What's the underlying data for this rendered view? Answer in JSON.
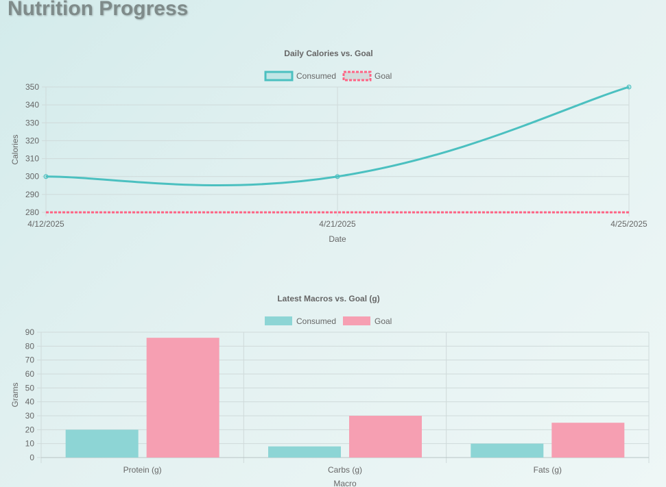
{
  "page": {
    "title": "Nutrition Progress"
  },
  "colors": {
    "consumed": "#4bc0c0",
    "goal": "#ff6384",
    "consumed_fill": "#8dd5d5",
    "goal_fill": "#f69fb2",
    "grid": "#cfdada",
    "text": "#666666"
  },
  "chart_data": [
    {
      "type": "line",
      "title": "Daily Calories vs. Goal",
      "xlabel": "Date",
      "ylabel": "Calories",
      "categories": [
        "4/12/2025",
        "4/21/2025",
        "4/25/2025"
      ],
      "series": [
        {
          "name": "Consumed",
          "values": [
            300,
            300,
            350
          ]
        },
        {
          "name": "Goal",
          "values": [
            280,
            280,
            280
          ]
        }
      ],
      "ylim": [
        280,
        350
      ],
      "yticks": [
        280,
        290,
        300,
        310,
        320,
        330,
        340,
        350
      ],
      "legend": "top-center",
      "grid": true
    },
    {
      "type": "bar",
      "title": "Latest Macros vs. Goal (g)",
      "xlabel": "Macro",
      "ylabel": "Grams",
      "categories": [
        "Protein (g)",
        "Carbs (g)",
        "Fats (g)"
      ],
      "series": [
        {
          "name": "Consumed",
          "values": [
            20,
            8,
            10
          ]
        },
        {
          "name": "Goal",
          "values": [
            86,
            30,
            25
          ]
        }
      ],
      "ylim": [
        0,
        90
      ],
      "yticks": [
        0,
        10,
        20,
        30,
        40,
        50,
        60,
        70,
        80,
        90
      ],
      "legend": "top-center",
      "grid": true
    }
  ]
}
